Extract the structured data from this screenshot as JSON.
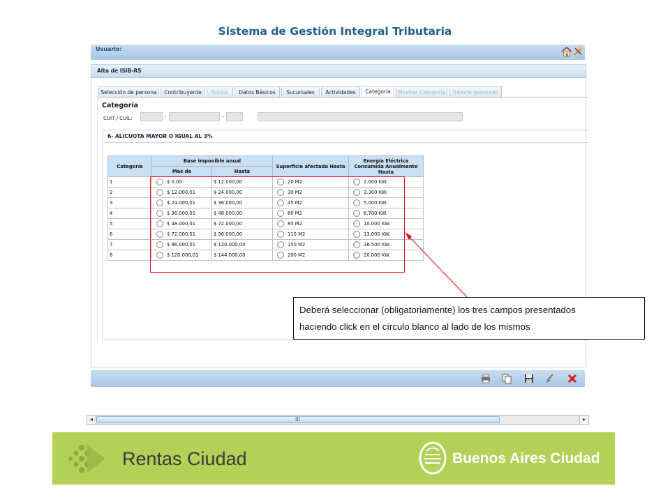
{
  "app": {
    "title": "Sistema de Gestión Integral Tributaria",
    "user_label": "Usuario:"
  },
  "panel": {
    "title": "Alta de ISIB-RS"
  },
  "tabs": [
    {
      "label": "Selección de persona",
      "state": "normal"
    },
    {
      "label": "Contribuyente",
      "state": "normal"
    },
    {
      "label": "Socios",
      "state": "disabled"
    },
    {
      "label": "Datos Básicos",
      "state": "normal"
    },
    {
      "label": "Sucursales",
      "state": "normal"
    },
    {
      "label": "Actividades",
      "state": "normal"
    },
    {
      "label": "Categoría",
      "state": "active"
    },
    {
      "label": "Mostrar Categoría",
      "state": "disabled"
    },
    {
      "label": "Trámite generado",
      "state": "disabled"
    }
  ],
  "form": {
    "section_title": "Categoría",
    "cuit_label": "CUIT / CUIL:",
    "dash": "-",
    "category_title": "6- ALICUOTA MAYOR O IGUAL AL 3%"
  },
  "table": {
    "headers": {
      "categoria": "Categoría",
      "base": "Base imponible anual",
      "mas_de": "Mas de",
      "hasta": "Hasta",
      "superficie": "Superficie afectada Hasta",
      "energia": "Energía Eléctrica Consumida Anualmente Hasta"
    },
    "rows": [
      {
        "cat": "1",
        "mas_de": "$ 0.00",
        "hasta": "$ 12.000,00",
        "sup": "20 M2",
        "ene": "2.000 KW."
      },
      {
        "cat": "2",
        "mas_de": "$ 12.000,01",
        "hasta": "$ 24.000,00",
        "sup": "30 M2",
        "ene": "3.300 KW."
      },
      {
        "cat": "3",
        "mas_de": "$ 24.000,01",
        "hasta": "$ 36.000,00",
        "sup": "45 M2",
        "ene": "5.000 KW."
      },
      {
        "cat": "4",
        "mas_de": "$ 36.000,01",
        "hasta": "$ 48.000,00",
        "sup": "60 M2",
        "ene": "6.700 KW."
      },
      {
        "cat": "5",
        "mas_de": "$ 48.000,01",
        "hasta": "$ 72.000,00",
        "sup": "85 M2",
        "ene": "10.000 KW."
      },
      {
        "cat": "6",
        "mas_de": "$ 72.000,01",
        "hasta": "$ 96.000,00",
        "sup": "110 M2",
        "ene": "13.000 KW."
      },
      {
        "cat": "7",
        "mas_de": "$ 96.000,01",
        "hasta": "$ 120.000,00",
        "sup": "150 M2",
        "ene": "16.500 KW."
      },
      {
        "cat": "8",
        "mas_de": "$ 120.000,01",
        "hasta": "$ 144.000,00",
        "sup": "200 M2",
        "ene": "20.000 KW."
      }
    ]
  },
  "callout": {
    "line1": "Deberá seleccionar (obligatoriamente) los tres campos presentados",
    "line2": "haciendo click en el círculo blanco al lado de los mismos"
  },
  "toolbar": {
    "icons": [
      "print-icon",
      "copy-icon",
      "save-icon",
      "clean-icon",
      "close-icon"
    ]
  },
  "scrollbar": {
    "grip": "III"
  },
  "footer": {
    "left_brand": "Rentas Ciudad",
    "right_brand": "Buenos Aires Ciudad"
  },
  "colors": {
    "header_blue": "#1f5f8b",
    "footer_green": "#b3d057",
    "highlight_red": "#e01010"
  }
}
